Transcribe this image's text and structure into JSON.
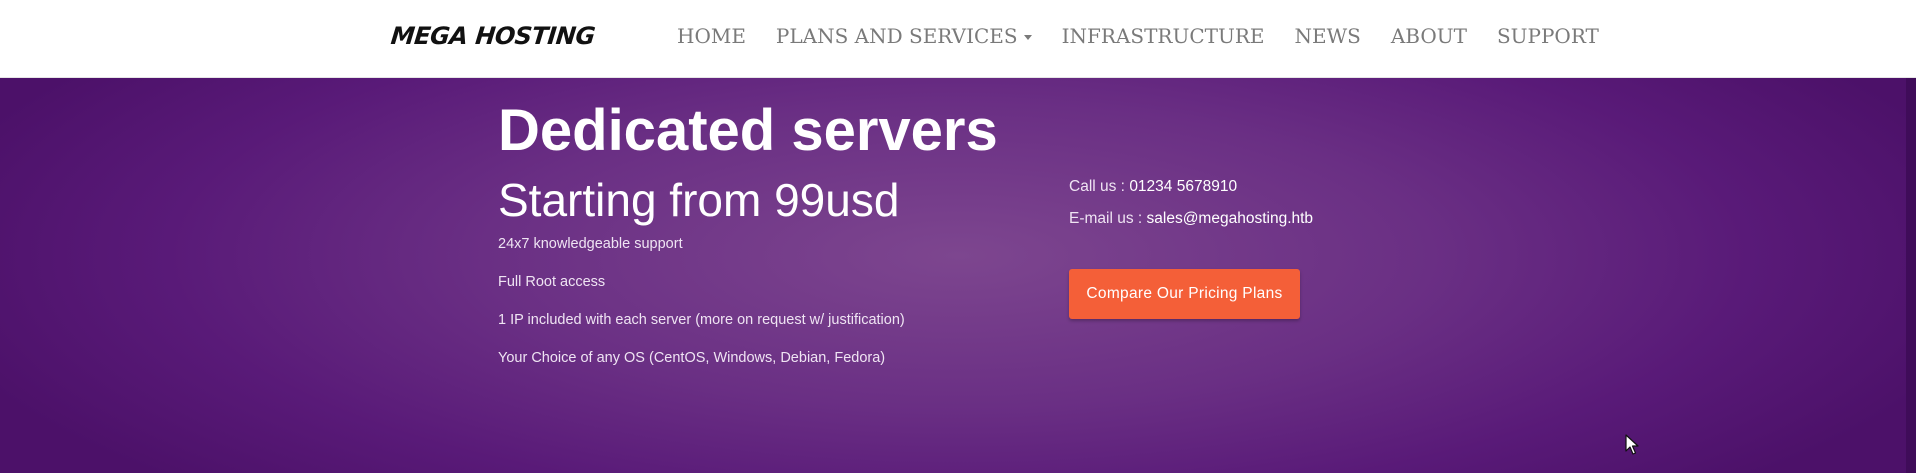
{
  "brand": "MEGA HOSTING",
  "nav": {
    "items": [
      {
        "label": "HOME"
      },
      {
        "label": "PLANS AND SERVICES"
      },
      {
        "label": "INFRASTRUCTURE"
      },
      {
        "label": "NEWS"
      },
      {
        "label": "ABOUT"
      },
      {
        "label": "SUPPORT"
      }
    ]
  },
  "hero": {
    "title": "Dedicated servers",
    "subtitle": "Starting from 99usd",
    "features": [
      "24x7 knowledgeable support",
      "Full Root access",
      "1 IP included with each server (more on request w/ justification)",
      "Your Choice of any OS (CentOS, Windows, Debian, Fedora)"
    ],
    "contact": {
      "call_label": "Call us : ",
      "call_value": "01234 5678910",
      "email_label": "E-mail us : ",
      "email_value": "sales@megahosting.htb"
    },
    "cta_label": "Compare Our Pricing Plans"
  },
  "colors": {
    "hero_bg": "#6a2f84",
    "cta_bg": "#f45f38",
    "nav_text": "#7a7a7a"
  },
  "icons": {
    "dropdown": "caret-down-icon",
    "pointer": "mouse-cursor-icon"
  }
}
